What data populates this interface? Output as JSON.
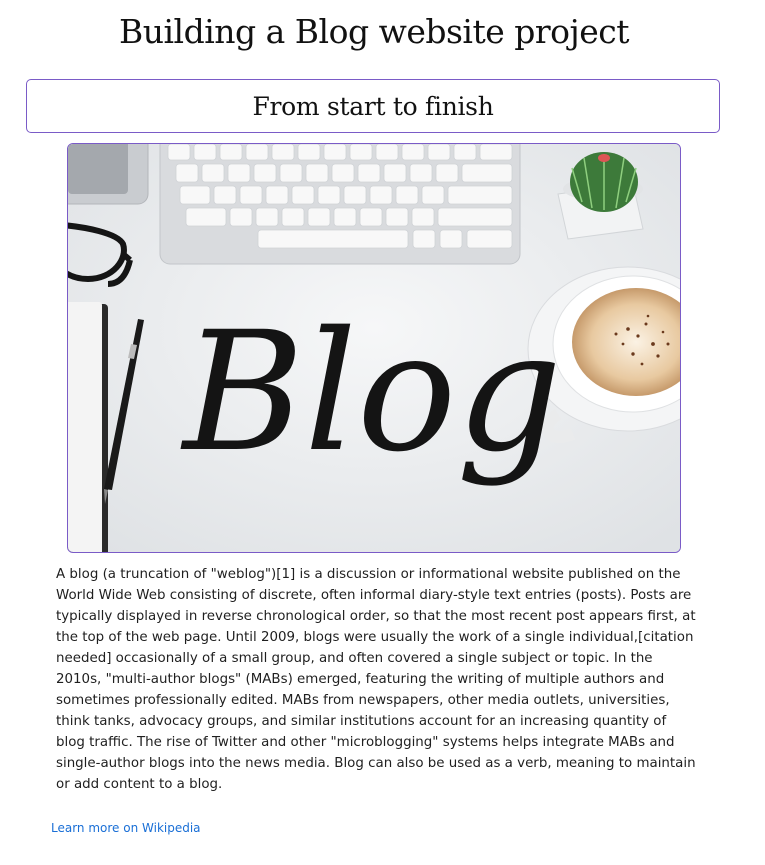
{
  "page": {
    "title": "Building a Blog website project",
    "subtitle": "From start to finish"
  },
  "hero_image": {
    "text": "Blog"
  },
  "article": {
    "body": "A blog (a truncation of \"weblog\")[1] is a discussion or informational website published on the World Wide Web consisting of discrete, often informal diary-style text entries (posts). Posts are typically displayed in reverse chronological order, so that the most recent post appears first, at the top of the web page. Until 2009, blogs were usually the work of a single individual,[citation needed] occasionally of a small group, and often covered a single subject or topic. In the 2010s, \"multi-author blogs\" (MABs) emerged, featuring the writing of multiple authors and sometimes professionally edited. MABs from newspapers, other media outlets, universities, think tanks, advocacy groups, and similar institutions account for an increasing quantity of blog traffic. The rise of Twitter and other \"microblogging\" systems helps integrate MABs and single-author blogs into the news media. Blog can also be used as a verb, meaning to maintain or add content to a blog."
  },
  "link": {
    "label": "Learn more on Wikipedia"
  },
  "colors": {
    "accent_border": "#7a5bc7",
    "link": "#1a6fd6"
  }
}
